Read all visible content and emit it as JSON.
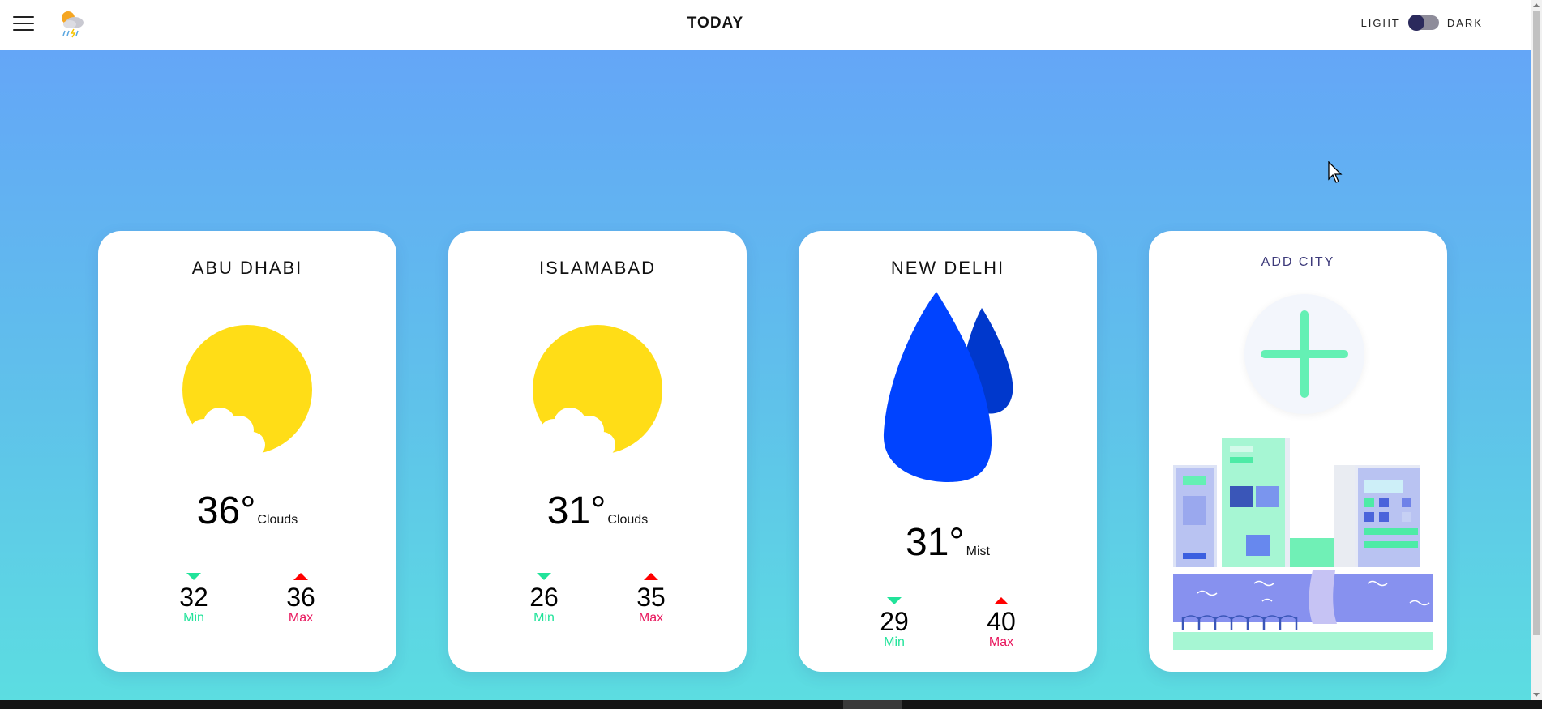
{
  "header": {
    "menu_icon": "hamburger-menu-icon",
    "logo_icon": "weather-logo-icon",
    "title": "TODAY",
    "theme_light_label": "LIGHT",
    "theme_dark_label": "DARK",
    "theme_mode": "light"
  },
  "colors": {
    "gradient_top": "#64a6f7",
    "gradient_bottom": "#5cdde1",
    "sun": "#ffdd17",
    "drop": "#0043ff",
    "min": "#21e39a",
    "max": "#e8175d"
  },
  "cards": [
    {
      "city": "ABU DHABI",
      "icon": "sun-cloud-icon",
      "temp": "36°",
      "condition": "Clouds",
      "min": "32",
      "max": "36",
      "min_label": "Min",
      "max_label": "Max"
    },
    {
      "city": "ISLAMABAD",
      "icon": "sun-cloud-icon",
      "temp": "31°",
      "condition": "Clouds",
      "min": "26",
      "max": "35",
      "min_label": "Min",
      "max_label": "Max"
    },
    {
      "city": "NEW DELHI",
      "icon": "raindrops-icon",
      "temp": "31°",
      "condition": "Mist",
      "min": "29",
      "max": "40",
      "min_label": "Min",
      "max_label": "Max"
    }
  ],
  "add_city": {
    "label": "ADD CITY",
    "icon": "plus-icon",
    "illustration": "cityscape-illustration"
  }
}
